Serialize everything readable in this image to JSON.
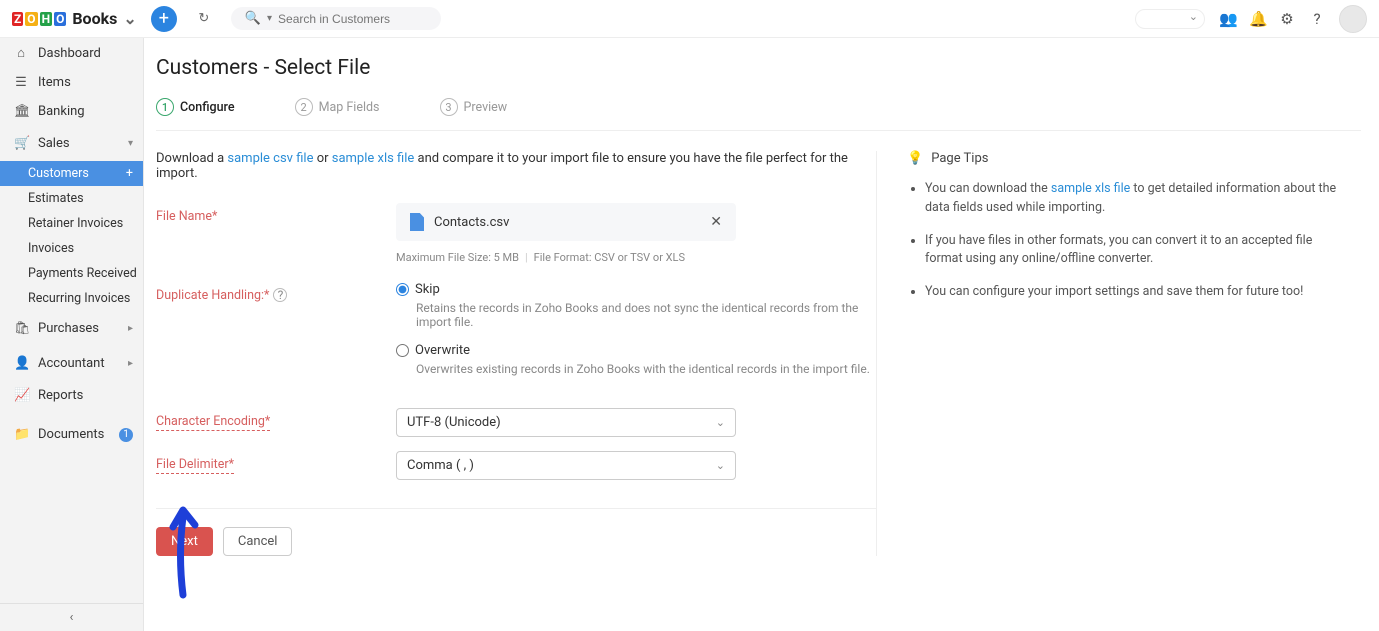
{
  "brand": {
    "name": "Books"
  },
  "search": {
    "placeholder": "Search in Customers"
  },
  "sidebar": {
    "dashboard": "Dashboard",
    "items": "Items",
    "banking": "Banking",
    "sales": "Sales",
    "sales_children": {
      "customers": "Customers",
      "estimates": "Estimates",
      "retainer": "Retainer Invoices",
      "invoices": "Invoices",
      "payments": "Payments Received",
      "recurring": "Recurring Invoices"
    },
    "purchases": "Purchases",
    "accountant": "Accountant",
    "reports": "Reports",
    "documents": "Documents",
    "documents_badge": "1"
  },
  "page": {
    "title": "Customers - Select File",
    "steps": {
      "s1": "Configure",
      "s2": "Map Fields",
      "s3": "Preview"
    },
    "intro_pre": "Download a ",
    "intro_csv": "sample csv file",
    "intro_or": " or ",
    "intro_xls": "sample xls file",
    "intro_post": " and compare it to your import file to ensure you have the file perfect for the import.",
    "labels": {
      "file": "File Name*",
      "dup": "Duplicate Handling:*",
      "enc": "Character Encoding*",
      "delim": "File Delimiter*"
    },
    "file": {
      "name": "Contacts.csv",
      "hint_size": "Maximum File Size: 5 MB",
      "hint_fmt": "File Format: CSV or TSV or XLS"
    },
    "dup": {
      "skip_label": "Skip",
      "skip_desc": "Retains the records in Zoho Books and does not sync the identical records from the import file.",
      "over_label": "Overwrite",
      "over_desc": "Overwrites existing records in Zoho Books with the identical records in the import file."
    },
    "enc_value": "UTF-8 (Unicode)",
    "delim_value": "Comma ( , )",
    "actions": {
      "next": "Next",
      "cancel": "Cancel"
    }
  },
  "tips": {
    "heading": "Page Tips",
    "t1a": "You can download the ",
    "t1link": "sample xls file",
    "t1b": " to get detailed information about the data fields used while importing.",
    "t2": "If you have files in other formats, you can convert it to an accepted file format using any online/offline converter.",
    "t3": "You can configure your import settings and save them for future too!"
  }
}
